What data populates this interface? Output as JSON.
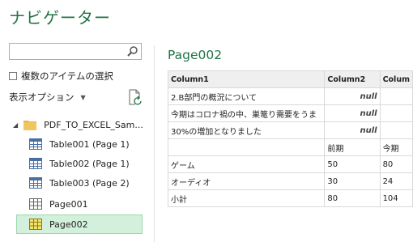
{
  "navigator": {
    "title": "ナビゲーター",
    "search": {
      "value": "",
      "placeholder": ""
    },
    "multi_select_label": "複数のアイテムの選択",
    "display_options_label": "表示オプション",
    "tree": {
      "folder": "PDF_TO_EXCEL_Sam...",
      "items": [
        {
          "label": "Table001 (Page 1)",
          "icon": "table-icon"
        },
        {
          "label": "Table002 (Page 1)",
          "icon": "table-icon"
        },
        {
          "label": "Table003 (Page 2)",
          "icon": "table-icon"
        },
        {
          "label": "Page001",
          "icon": "page-icon"
        },
        {
          "label": "Page002",
          "icon": "page-icon",
          "selected": true
        }
      ]
    }
  },
  "preview": {
    "title": "Page002",
    "columns": [
      "Column1",
      "Column2",
      "Colum"
    ],
    "rows": [
      [
        "2.B部門の概況について",
        "null",
        ""
      ],
      [
        "今期はコロナ禍の中、巣篭り需要をうま",
        "null",
        ""
      ],
      [
        "30%の増加となりました",
        "null",
        ""
      ],
      [
        "",
        "前期",
        "今期"
      ],
      [
        "ゲーム",
        "50",
        "80"
      ],
      [
        "オーディオ",
        "30",
        "24"
      ],
      [
        "小計",
        "80",
        "104"
      ]
    ]
  },
  "colors": {
    "accent": "#217346",
    "selected_bg": "#d3f0dc"
  }
}
